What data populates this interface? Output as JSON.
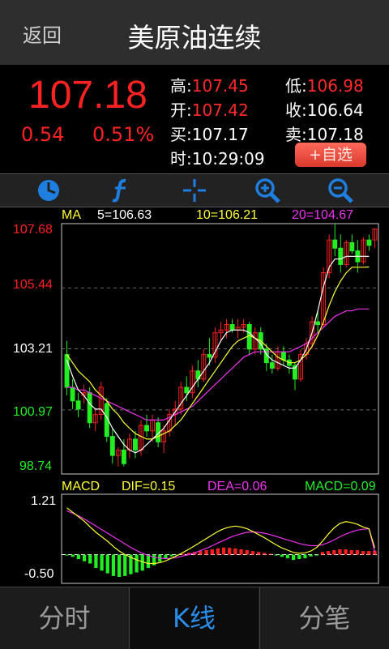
{
  "header": {
    "back_label": "返回",
    "title": "美原油连续"
  },
  "quote": {
    "price": "107.18",
    "change": "0.54",
    "change_pct": "0.51%",
    "high_label": "高:",
    "high": "107.45",
    "low_label": "低:",
    "low": "106.98",
    "open_label": "开:",
    "open": "107.42",
    "close_label": "收:",
    "close": "106.64",
    "bid_label": "买:",
    "bid": "107.17",
    "ask_label": "卖:",
    "ask": "107.18",
    "time_label": "时:",
    "time": "10:29:09",
    "add_label": "+自选"
  },
  "toolbar": {
    "icons": [
      "clock-icon",
      "function-icon",
      "crosshair-icon",
      "zoom-in-icon",
      "zoom-out-icon"
    ]
  },
  "chart_data": [
    {
      "type": "candlestick",
      "title": "",
      "ma_label": "MA",
      "ma5_label": "5=106.63",
      "ma10_label": "10=106.21",
      "ma20_label": "20=104.67",
      "y_ticks": [
        "107.68",
        "105.44",
        "103.21",
        "100.97",
        "98.74"
      ],
      "ylim": [
        98.74,
        107.68
      ],
      "colors": {
        "up": "#ff2020",
        "down": "#22ee22",
        "ma5": "#ffffff",
        "ma10": "#ffff33",
        "ma20": "#ee33ee"
      },
      "candles": [
        [
          103.0,
          103.5,
          101.5,
          101.8
        ],
        [
          101.8,
          102.1,
          101.0,
          101.3
        ],
        [
          101.3,
          101.6,
          100.7,
          101.0
        ],
        [
          101.5,
          101.9,
          101.2,
          101.6
        ],
        [
          101.6,
          101.8,
          100.3,
          100.5
        ],
        [
          100.5,
          101.0,
          100.2,
          100.8
        ],
        [
          100.8,
          102.0,
          100.6,
          101.8
        ],
        [
          101.2,
          101.4,
          99.8,
          100.0
        ],
        [
          100.0,
          100.3,
          99.0,
          99.3
        ],
        [
          99.3,
          99.6,
          98.9,
          99.5
        ],
        [
          99.5,
          99.9,
          98.9,
          99.0
        ],
        [
          99.5,
          100.1,
          99.2,
          99.9
        ],
        [
          99.9,
          100.2,
          99.2,
          99.5
        ],
        [
          99.5,
          100.6,
          99.3,
          100.4
        ],
        [
          100.4,
          100.8,
          100.0,
          100.2
        ],
        [
          100.2,
          100.8,
          99.8,
          100.6
        ],
        [
          100.5,
          100.7,
          99.6,
          99.8
        ],
        [
          99.8,
          100.4,
          99.4,
          100.2
        ],
        [
          100.2,
          101.0,
          100.0,
          100.8
        ],
        [
          100.8,
          101.3,
          100.4,
          101.0
        ],
        [
          101.0,
          102.0,
          100.8,
          101.8
        ],
        [
          101.8,
          102.2,
          101.3,
          101.6
        ],
        [
          101.6,
          102.6,
          101.4,
          102.4
        ],
        [
          102.4,
          102.8,
          101.8,
          102.1
        ],
        [
          102.1,
          103.2,
          102.0,
          103.0
        ],
        [
          103.0,
          103.6,
          102.6,
          102.9
        ],
        [
          102.9,
          104.0,
          102.7,
          103.8
        ],
        [
          103.8,
          104.2,
          103.5,
          103.9
        ],
        [
          103.9,
          104.3,
          103.6,
          104.1
        ],
        [
          104.1,
          104.3,
          103.8,
          103.9
        ],
        [
          103.9,
          104.3,
          103.6,
          104.0
        ],
        [
          104.0,
          104.3,
          103.8,
          104.1
        ],
        [
          104.1,
          104.2,
          103.0,
          103.2
        ],
        [
          103.2,
          104.0,
          103.0,
          103.8
        ],
        [
          103.8,
          104.0,
          103.0,
          103.2
        ],
        [
          103.2,
          103.4,
          102.4,
          102.7
        ],
        [
          102.7,
          103.0,
          102.3,
          102.5
        ],
        [
          102.5,
          103.3,
          102.4,
          103.1
        ],
        [
          103.1,
          103.3,
          102.6,
          102.8
        ],
        [
          102.8,
          103.0,
          102.3,
          102.6
        ],
        [
          102.6,
          102.7,
          101.7,
          102.1
        ],
        [
          102.1,
          103.2,
          102.0,
          103.0
        ],
        [
          103.0,
          103.6,
          102.8,
          103.4
        ],
        [
          103.4,
          104.4,
          103.2,
          104.2
        ],
        [
          104.2,
          104.6,
          103.8,
          104.1
        ],
        [
          104.1,
          106.2,
          104.0,
          106.0
        ],
        [
          106.0,
          107.4,
          105.8,
          107.2
        ],
        [
          107.2,
          107.8,
          106.6,
          106.9
        ],
        [
          106.9,
          107.4,
          106.0,
          106.3
        ],
        [
          106.3,
          107.2,
          106.2,
          107.1
        ],
        [
          107.1,
          107.4,
          106.7,
          106.8
        ],
        [
          106.8,
          107.2,
          106.0,
          106.4
        ],
        [
          106.4,
          107.3,
          106.3,
          107.2
        ],
        [
          107.2,
          107.4,
          106.8,
          107.0
        ],
        [
          107.2,
          107.6,
          106.9,
          107.6
        ]
      ],
      "ma5": [
        102.8,
        102.2,
        101.7,
        101.5,
        101.2,
        101.0,
        101.0,
        100.7,
        100.3,
        100.0,
        99.7,
        99.5,
        99.4,
        99.5,
        99.7,
        99.9,
        100.1,
        100.3,
        100.6,
        100.9,
        101.2,
        101.5,
        101.8,
        102.1,
        102.4,
        102.7,
        103.1,
        103.5,
        103.8,
        103.9,
        103.9,
        103.9,
        103.8,
        103.6,
        103.4,
        103.0,
        102.8,
        102.7,
        102.6,
        102.5,
        102.5,
        102.8,
        103.2,
        103.8,
        104.6,
        105.5,
        106.2,
        106.5,
        106.5,
        106.6,
        106.6,
        106.6,
        106.6,
        106.6
      ],
      "ma10": [
        103.0,
        102.7,
        102.4,
        102.2,
        102.0,
        101.7,
        101.5,
        101.3,
        101.0,
        100.8,
        100.5,
        100.3,
        100.1,
        100.0,
        99.9,
        99.9,
        100.0,
        100.1,
        100.2,
        100.4,
        100.6,
        100.9,
        101.2,
        101.5,
        101.8,
        102.1,
        102.4,
        102.7,
        103.0,
        103.3,
        103.5,
        103.6,
        103.7,
        103.6,
        103.5,
        103.3,
        103.1,
        102.9,
        102.8,
        102.7,
        102.7,
        102.8,
        103.0,
        103.3,
        103.7,
        104.2,
        104.8,
        105.3,
        105.7,
        106.0,
        106.2,
        106.2,
        106.2,
        106.21
      ],
      "ma20": [
        101.8,
        101.8,
        101.7,
        101.7,
        101.6,
        101.5,
        101.4,
        101.3,
        101.2,
        101.1,
        101.0,
        100.9,
        100.8,
        100.7,
        100.6,
        100.6,
        100.6,
        100.6,
        100.7,
        100.8,
        100.9,
        101.0,
        101.1,
        101.3,
        101.5,
        101.7,
        101.9,
        102.1,
        102.3,
        102.5,
        102.7,
        102.9,
        103.0,
        103.1,
        103.1,
        103.1,
        103.1,
        103.1,
        103.1,
        103.1,
        103.2,
        103.3,
        103.4,
        103.6,
        103.8,
        104.0,
        104.2,
        104.4,
        104.5,
        104.6,
        104.6,
        104.67,
        104.67,
        104.67
      ]
    },
    {
      "type": "macd",
      "title": "",
      "label": "MACD",
      "dif_label": "DIF=0.15",
      "dea_label": "DEA=0.06",
      "macd_label": "MACD=0.09",
      "y_ticks": [
        "1.21",
        "-0.50"
      ],
      "ylim": [
        -0.5,
        1.21
      ],
      "zero": 0,
      "colors": {
        "pos": "#ff2020",
        "neg": "#22ee22",
        "dif": "#ffff33",
        "dea": "#ee33ee"
      },
      "hist": [
        -0.02,
        -0.05,
        -0.1,
        -0.15,
        -0.2,
        -0.3,
        -0.36,
        -0.42,
        -0.48,
        -0.5,
        -0.48,
        -0.44,
        -0.4,
        -0.36,
        -0.3,
        -0.24,
        -0.16,
        -0.1,
        -0.04,
        -0.02,
        0.02,
        0.04,
        0.06,
        0.08,
        0.1,
        0.12,
        0.14,
        0.16,
        0.15,
        0.14,
        0.12,
        0.1,
        0.08,
        0.06,
        0.04,
        0.02,
        -0.02,
        -0.05,
        -0.08,
        -0.12,
        -0.1,
        -0.08,
        -0.04,
        -0.02,
        0.06,
        0.08,
        0.1,
        0.12,
        0.12,
        0.1,
        0.1,
        0.08,
        0.08,
        0.09
      ],
      "dif": [
        1.05,
        0.95,
        0.85,
        0.75,
        0.62,
        0.5,
        0.4,
        0.3,
        0.18,
        0.08,
        0.0,
        -0.06,
        -0.12,
        -0.16,
        -0.2,
        -0.2,
        -0.18,
        -0.14,
        -0.08,
        -0.02,
        0.05,
        0.12,
        0.2,
        0.28,
        0.36,
        0.44,
        0.52,
        0.58,
        0.62,
        0.64,
        0.62,
        0.58,
        0.52,
        0.45,
        0.38,
        0.3,
        0.22,
        0.15,
        0.1,
        0.05,
        0.03,
        0.04,
        0.08,
        0.16,
        0.3,
        0.46,
        0.6,
        0.7,
        0.74,
        0.72,
        0.68,
        0.62,
        0.58,
        0.15
      ],
      "dea": [
        0.98,
        0.93,
        0.87,
        0.8,
        0.72,
        0.64,
        0.56,
        0.48,
        0.4,
        0.32,
        0.24,
        0.16,
        0.09,
        0.03,
        -0.02,
        -0.06,
        -0.08,
        -0.09,
        -0.08,
        -0.06,
        -0.03,
        0.0,
        0.04,
        0.09,
        0.14,
        0.2,
        0.26,
        0.32,
        0.38,
        0.43,
        0.47,
        0.5,
        0.51,
        0.5,
        0.48,
        0.45,
        0.41,
        0.37,
        0.33,
        0.29,
        0.25,
        0.22,
        0.2,
        0.2,
        0.22,
        0.27,
        0.33,
        0.4,
        0.46,
        0.51,
        0.55,
        0.57,
        0.58,
        0.06
      ]
    }
  ],
  "tabs": [
    {
      "label": "分时",
      "active": false
    },
    {
      "label": "K线",
      "active": true
    },
    {
      "label": "分笔",
      "active": false
    }
  ]
}
